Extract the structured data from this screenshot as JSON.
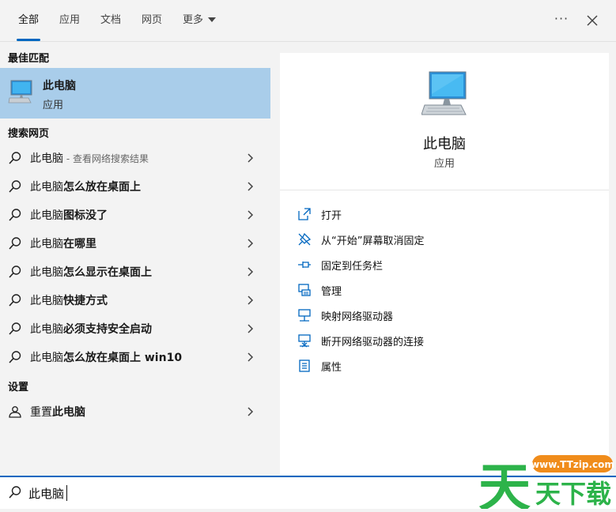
{
  "tabs": [
    {
      "label": "全部",
      "active": true
    },
    {
      "label": "应用"
    },
    {
      "label": "文档"
    },
    {
      "label": "网页"
    },
    {
      "label": "更多"
    }
  ],
  "top_actions": {
    "more": "···"
  },
  "left": {
    "best_match_header": "最佳匹配",
    "best_match": {
      "title": "此电脑",
      "subtitle": "应用"
    },
    "web_header": "搜索网页",
    "web_results": [
      {
        "prefix": "此电脑",
        "bold": "",
        "hint": " - 查看网络搜索结果"
      },
      {
        "prefix": "此电脑",
        "bold": "怎么放在桌面上",
        "hint": ""
      },
      {
        "prefix": "此电脑",
        "bold": "图标没了",
        "hint": ""
      },
      {
        "prefix": "此电脑",
        "bold": "在哪里",
        "hint": ""
      },
      {
        "prefix": "此电脑",
        "bold": "怎么显示在桌面上",
        "hint": ""
      },
      {
        "prefix": "此电脑",
        "bold": "快捷方式",
        "hint": ""
      },
      {
        "prefix": "此电脑",
        "bold": "必须支持安全启动",
        "hint": ""
      },
      {
        "prefix": "此电脑",
        "bold": "怎么放在桌面上 win10",
        "hint": ""
      }
    ],
    "settings_header": "设置",
    "settings_results": [
      {
        "prefix": "重置",
        "bold": "此电脑"
      }
    ]
  },
  "right": {
    "title": "此电脑",
    "subtitle": "应用",
    "actions": [
      {
        "icon": "open-icon",
        "label": "打开"
      },
      {
        "icon": "unpin-icon",
        "label": "从“开始”屏幕取消固定"
      },
      {
        "icon": "pin-icon",
        "label": "固定到任务栏"
      },
      {
        "icon": "manage-icon",
        "label": "管理"
      },
      {
        "icon": "map-drive-icon",
        "label": "映射网络驱动器"
      },
      {
        "icon": "disconnect-drive-icon",
        "label": "断开网络驱动器的连接"
      },
      {
        "icon": "properties-icon",
        "label": "属性"
      }
    ]
  },
  "search": {
    "value": "此电脑"
  },
  "watermark": {
    "site": "www.TTzip.com",
    "cn": "天下载"
  },
  "colors": {
    "accent": "#0067c0",
    "highlight": "#a9cdea",
    "watermark_green": "#2db34a",
    "watermark_orange": "#f08c1b"
  }
}
